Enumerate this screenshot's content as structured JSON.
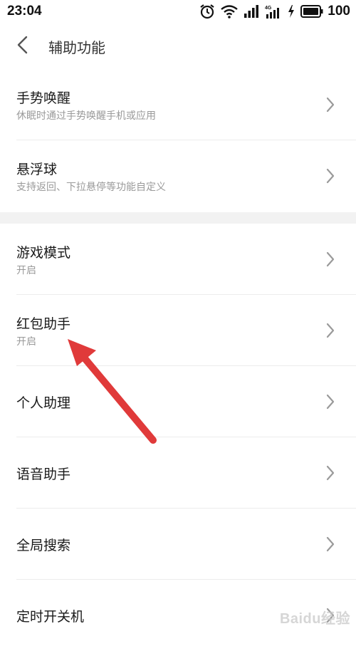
{
  "status_bar": {
    "time": "23:04",
    "network_label": "4G",
    "battery_text": "100"
  },
  "header": {
    "title": "辅助功能"
  },
  "group1": [
    {
      "title": "手势唤醒",
      "subtitle": "休眠时通过手势唤醒手机或应用"
    },
    {
      "title": "悬浮球",
      "subtitle": "支持返回、下拉悬停等功能自定义"
    }
  ],
  "group2": [
    {
      "title": "游戏模式",
      "subtitle": "开启"
    },
    {
      "title": "红包助手",
      "subtitle": "开启"
    },
    {
      "title": "个人助理",
      "subtitle": ""
    },
    {
      "title": "语音助手",
      "subtitle": ""
    },
    {
      "title": "全局搜索",
      "subtitle": ""
    },
    {
      "title": "定时开关机",
      "subtitle": ""
    }
  ],
  "colors": {
    "background": "#ffffff",
    "section_gap": "#f2f2f2",
    "title_text": "#1a1a1a",
    "subtitle_text": "#9a9a9a",
    "chevron": "#9a9a9a",
    "annotation_arrow": "#e03a3a"
  },
  "icons": [
    "alarm-icon",
    "wifi-icon",
    "signal-icon",
    "signal-4g-icon",
    "charging-icon",
    "battery-icon",
    "back-icon",
    "chevron-right-icon"
  ],
  "watermark": {
    "text": "Baidu经验"
  }
}
